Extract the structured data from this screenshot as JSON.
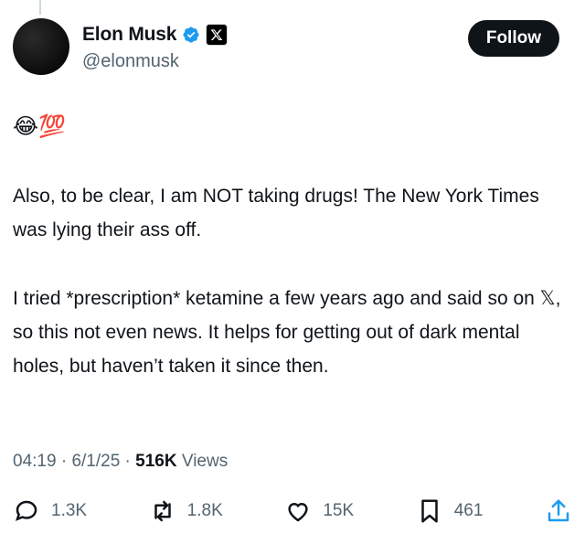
{
  "author": {
    "display_name": "Elon Musk",
    "handle": "@elonmusk",
    "verified_color": "#1d9bf0"
  },
  "follow_label": "Follow",
  "tweet": {
    "emoji_line": "😂💯",
    "paragraph1": "Also, to be clear, I am NOT taking drugs! The New York Times was lying their ass off.",
    "paragraph2": "I tried *prescription* ketamine a few years ago and said so on 𝕏, so this not even news. It helps for getting out of dark mental holes, but haven’t taken it since then."
  },
  "meta": {
    "time": "04:19",
    "date": "6/1/25",
    "views_count": "516K",
    "views_label": "Views",
    "separator": "·"
  },
  "actions": {
    "replies": "1.3K",
    "reposts": "1.8K",
    "likes": "15K",
    "bookmarks": "461"
  },
  "icons": [
    "reply-icon",
    "repost-icon",
    "like-icon",
    "bookmark-icon",
    "share-icon",
    "verified-icon",
    "x-logo-icon"
  ]
}
